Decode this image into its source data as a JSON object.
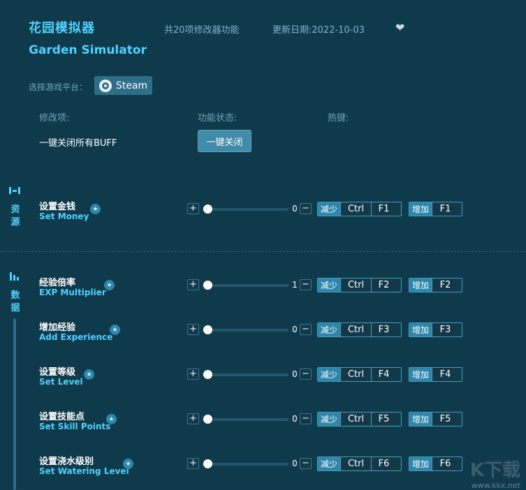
{
  "header": {
    "title_cn": "花园模拟器",
    "title_en": "Garden Simulator",
    "feature_count": "共20项修改器功能",
    "update_date": "更新日期:2022-10-03",
    "favorite_icon": "heart-icon"
  },
  "platform": {
    "label": "选择游戏平台：",
    "button": "Steam",
    "icon": "steam-icon"
  },
  "columns": {
    "mod": "修改项:",
    "status": "功能状态:",
    "hotkey": "热键:"
  },
  "buff": {
    "label": "一键关闭所有BUFF",
    "button": "一键关闭"
  },
  "categories": [
    {
      "name": "资\n源",
      "icon": "resource-icon"
    },
    {
      "name": "数\n据",
      "icon": "data-bars-icon"
    }
  ],
  "hotkey_labels": {
    "decrease": "减少",
    "increase": "增加",
    "ctrl": "Ctrl"
  },
  "items": [
    {
      "cn": "设置金钱",
      "en": "Set Money",
      "value": "0",
      "key": "F1"
    },
    {
      "cn": "经验倍率",
      "en": "EXP Multiplier",
      "value": "1",
      "key": "F2"
    },
    {
      "cn": "增加经验",
      "en": "Add Experience",
      "value": "0",
      "key": "F3"
    },
    {
      "cn": "设置等级",
      "en": "Set Level",
      "value": "0",
      "key": "F4"
    },
    {
      "cn": "设置技能点",
      "en": "Set Skill Points",
      "value": "0",
      "key": "F5"
    },
    {
      "cn": "设置浇水级别",
      "en": "Set Watering Level",
      "value": "0",
      "key": "F6"
    }
  ],
  "watermark": {
    "big": "K下载",
    "small": "www.kkx.net"
  },
  "colors": {
    "background": "#0f3a4c",
    "accent": "#4fd2ff",
    "tag": "#2d86aa"
  }
}
